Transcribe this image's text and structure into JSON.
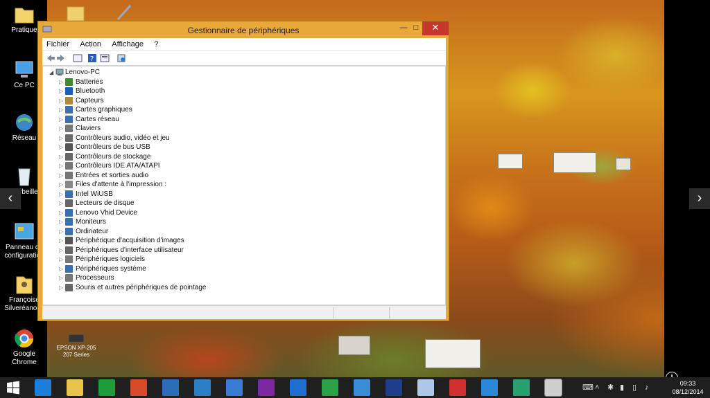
{
  "desktop": {
    "icons": [
      {
        "label": "Pratique",
        "icon": "folder-icon"
      },
      {
        "label": "Ce PC",
        "icon": "computer-icon"
      },
      {
        "label": "Réseau",
        "icon": "network-icon"
      },
      {
        "label": "Corbeille",
        "icon": "recycle-bin-icon"
      },
      {
        "label": "Panneau de configuration",
        "icon": "control-panel-icon"
      },
      {
        "label": "Françoise Silveréano-R",
        "icon": "user-folder-icon"
      },
      {
        "label": "Google Chrome",
        "icon": "chrome-icon"
      }
    ],
    "printer_icon_label": "EPSON XP-205 207 Series",
    "nav_left": "‹",
    "nav_right": "›",
    "info_glyph": "i"
  },
  "window": {
    "title": "Gestionnaire de périphériques",
    "controls": {
      "minimize": "—",
      "maximize": "□",
      "close": "✕"
    },
    "menu": [
      "Fichier",
      "Action",
      "Affichage",
      "?"
    ],
    "toolbar": [
      "back-arrow-icon",
      "forward-arrow-icon",
      "properties-icon",
      "help-icon",
      "view-icon",
      "scan-hardware-icon"
    ],
    "tree": {
      "root": "Lenovo-PC",
      "items": [
        {
          "label": "Batteries",
          "icon": "battery-icon",
          "color": "#3d8b2f"
        },
        {
          "label": "Bluetooth",
          "icon": "bluetooth-icon",
          "color": "#1a5fb4"
        },
        {
          "label": "Capteurs",
          "icon": "sensor-icon",
          "color": "#b08a3a"
        },
        {
          "label": "Cartes graphiques",
          "icon": "display-adapter-icon",
          "color": "#3a6fb0"
        },
        {
          "label": "Cartes réseau",
          "icon": "network-adapter-icon",
          "color": "#3a6fb0"
        },
        {
          "label": "Claviers",
          "icon": "keyboard-icon",
          "color": "#777777"
        },
        {
          "label": "Contrôleurs audio, vidéo et jeu",
          "icon": "speaker-icon",
          "color": "#6a6a6a"
        },
        {
          "label": "Contrôleurs de bus USB",
          "icon": "usb-icon",
          "color": "#555555"
        },
        {
          "label": "Contrôleurs de stockage",
          "icon": "storage-icon",
          "color": "#666666"
        },
        {
          "label": "Contrôleurs IDE ATA/ATAPI",
          "icon": "ide-icon",
          "color": "#777777"
        },
        {
          "label": "Entrées et sorties audio",
          "icon": "audio-io-icon",
          "color": "#777777"
        },
        {
          "label": "Files d'attente à l'impression :",
          "icon": "printer-queue-icon",
          "color": "#888888"
        },
        {
          "label": "Intel WiUSB",
          "icon": "intel-wiusb-icon",
          "color": "#3a6fb0"
        },
        {
          "label": "Lecteurs de disque",
          "icon": "disk-drive-icon",
          "color": "#666666"
        },
        {
          "label": "Lenovo Vhid Device",
          "icon": "hid-device-icon",
          "color": "#3a6fb0"
        },
        {
          "label": "Moniteurs",
          "icon": "monitor-icon",
          "color": "#3a6fb0"
        },
        {
          "label": "Ordinateur",
          "icon": "computer-icon",
          "color": "#3a6fb0"
        },
        {
          "label": "Périphérique d'acquisition d'images",
          "icon": "camera-icon",
          "color": "#555555"
        },
        {
          "label": "Périphériques d'interface utilisateur",
          "icon": "hid-icon",
          "color": "#666666"
        },
        {
          "label": "Périphériques logiciels",
          "icon": "software-device-icon",
          "color": "#777777"
        },
        {
          "label": "Périphériques système",
          "icon": "system-device-icon",
          "color": "#3a6fb0"
        },
        {
          "label": "Processeurs",
          "icon": "processor-icon",
          "color": "#777777"
        },
        {
          "label": "Souris et autres périphériques de pointage",
          "icon": "mouse-icon",
          "color": "#666666"
        }
      ]
    }
  },
  "taskbar": {
    "items": [
      {
        "name": "internet-explorer-icon",
        "color": "#1e7fd8"
      },
      {
        "name": "file-explorer-icon",
        "color": "#e8c34a"
      },
      {
        "name": "store-icon",
        "color": "#1e9e3a"
      },
      {
        "name": "chrome-icon",
        "color": "#d84a2a"
      },
      {
        "name": "remote-desktop-icon",
        "color": "#2a6db8"
      },
      {
        "name": "app-blue-icon",
        "color": "#2a7fc8"
      },
      {
        "name": "google-icon",
        "color": "#3a7bd5"
      },
      {
        "name": "onenote-icon",
        "color": "#7a2a9e"
      },
      {
        "name": "mail-icon",
        "color": "#1e6fd0"
      },
      {
        "name": "calculator-icon",
        "color": "#2aa048"
      },
      {
        "name": "lenovo-app-icon",
        "color": "#3a8ed8"
      },
      {
        "name": "media-icon",
        "color": "#1f3d8a"
      },
      {
        "name": "sync-icon",
        "color": "#b0c8e8"
      },
      {
        "name": "flag-icon",
        "color": "#d03030"
      },
      {
        "name": "dropbox-icon",
        "color": "#2a88d8"
      },
      {
        "name": "green-app-icon",
        "color": "#2aa070"
      },
      {
        "name": "device-manager-task-icon",
        "color": "#cfcfcf"
      }
    ],
    "tray": [
      "keyboard-icon",
      "chevron-up-icon",
      "network-tray-icon",
      "signal-icon",
      "battery-tray-icon",
      "volume-icon"
    ],
    "time": "09:33",
    "date": "08/12/2014"
  }
}
